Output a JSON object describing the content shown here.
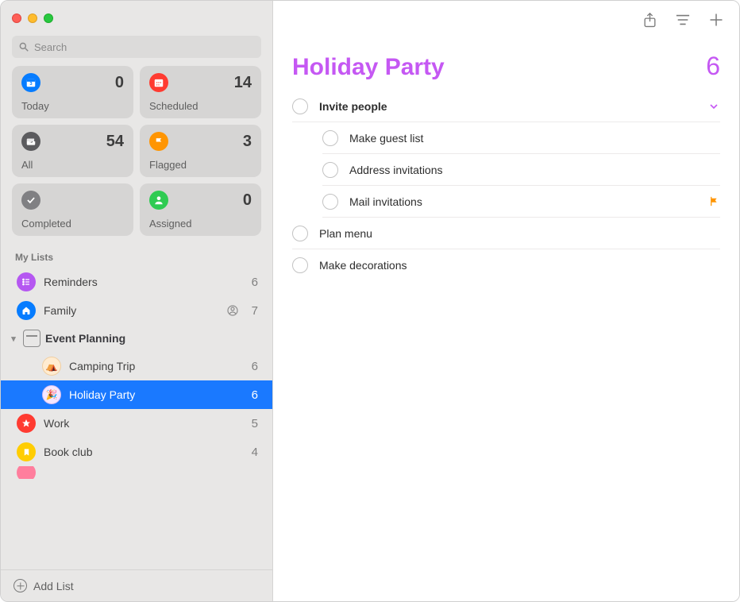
{
  "search": {
    "placeholder": "Search"
  },
  "smart": [
    {
      "id": "today",
      "label": "Today",
      "count": 0,
      "color": "bg-blue",
      "icon": "calendar"
    },
    {
      "id": "scheduled",
      "label": "Scheduled",
      "count": 14,
      "color": "bg-red",
      "icon": "calendar-dots"
    },
    {
      "id": "all",
      "label": "All",
      "count": 54,
      "color": "bg-dark",
      "icon": "tray"
    },
    {
      "id": "flagged",
      "label": "Flagged",
      "count": 3,
      "color": "bg-orange",
      "icon": "flag"
    },
    {
      "id": "completed",
      "label": "Completed",
      "count": "",
      "color": "bg-grey",
      "icon": "check"
    },
    {
      "id": "assigned",
      "label": "Assigned",
      "count": 0,
      "color": "bg-green",
      "icon": "person"
    }
  ],
  "sections_title": "My Lists",
  "lists": {
    "reminders": {
      "name": "Reminders",
      "count": 6
    },
    "family": {
      "name": "Family",
      "count": 7,
      "shared": true
    },
    "folder": {
      "name": "Event Planning"
    },
    "camping": {
      "name": "Camping Trip",
      "count": 6
    },
    "holiday": {
      "name": "Holiday Party",
      "count": 6
    },
    "work": {
      "name": "Work",
      "count": 5
    },
    "bookclub": {
      "name": "Book club",
      "count": 4
    }
  },
  "add_list_label": "Add List",
  "main": {
    "title": "Holiday Party",
    "count": 6,
    "items": {
      "invite": {
        "title": "Invite people"
      },
      "guest": {
        "title": "Make guest list"
      },
      "address": {
        "title": "Address invitations"
      },
      "mail": {
        "title": "Mail invitations",
        "flagged": true
      },
      "menu": {
        "title": "Plan menu"
      },
      "decor": {
        "title": "Make decorations"
      }
    }
  }
}
